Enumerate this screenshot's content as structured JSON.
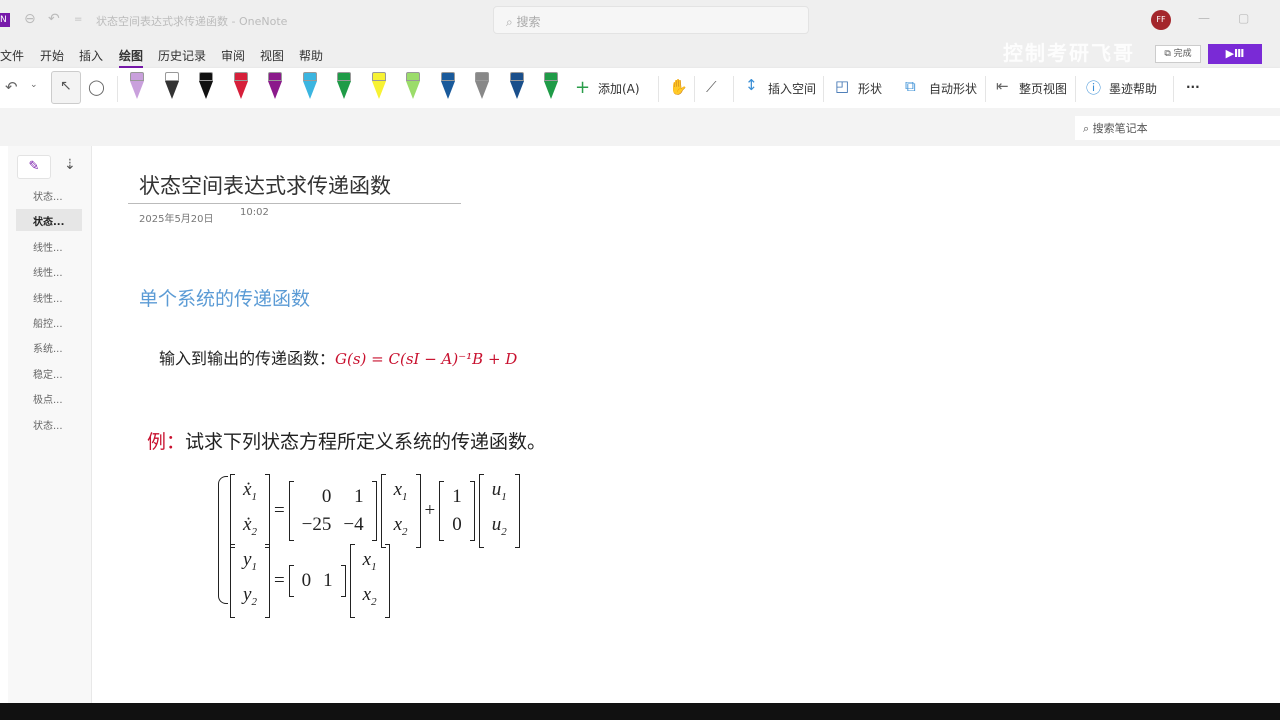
{
  "titlebar": {
    "app_badge": "N",
    "title": "状态空间表达式求传递函数 - OneNote",
    "search_placeholder": "搜索",
    "avatar": "FF"
  },
  "menu": [
    "文件",
    "开始",
    "插入",
    "绘图",
    "历史记录",
    "审阅",
    "视图",
    "帮助"
  ],
  "watermark": {
    "text": "控制考研飞哥",
    "btn": "⧉ 完成",
    "play": "▶Ⅲ"
  },
  "toolbar": {
    "pens": [
      {
        "cap": "#c9a0dc",
        "tip": "#c9a0dc"
      },
      {
        "cap": "#fff",
        "tip": "#333"
      },
      {
        "cap": "#111",
        "tip": "#111"
      },
      {
        "cap": "#d61f3a",
        "tip": "#d61f3a"
      },
      {
        "cap": "#8b1a8b",
        "tip": "#8b1a8b"
      },
      {
        "cap": "#3bb5e0",
        "tip": "#3bb5e0"
      },
      {
        "cap": "#1f9b47",
        "tip": "#1f9b47"
      },
      {
        "cap": "#f7f233",
        "tip": "#f7f233"
      },
      {
        "cap": "#9bdc6a",
        "tip": "#9bdc6a"
      },
      {
        "cap": "#1a5a9b",
        "tip": "#1a5a9b"
      },
      {
        "cap": "#888",
        "tip": "#888"
      },
      {
        "cap": "#1a4f8b",
        "tip": "#1a4f8b"
      },
      {
        "cap": "#1f9b47",
        "tip": "#1f9b47"
      }
    ],
    "add": "添加(A)",
    "insert_space": "插入空间",
    "shapes": "形状",
    "auto_shapes": "自动形状",
    "full_page_view": "整页视图",
    "ink_help": "墨迹帮助",
    "more": "···"
  },
  "notebook_search": "搜索笔记本",
  "pages": [
    "状态...",
    "状态...",
    "线性...",
    "线性...",
    "线性...",
    "船控...",
    "系统...",
    "稳定...",
    "极点...",
    "状态..."
  ],
  "active_page": 1,
  "page": {
    "title": "状态空间表达式求传递函数",
    "date": "2025年5月20日",
    "time": "10:02",
    "heading": "单个系统的传递函数",
    "io_label": "输入到输出的传递函数：",
    "formula": "G(s) = C(sI − A)⁻¹B + D",
    "example_label": "例：",
    "example_text": "试求下列状态方程所定义系统的传递函数。",
    "A": [
      "0",
      "1",
      "−25",
      "−4"
    ],
    "B": [
      "1",
      "0"
    ],
    "C": [
      "0",
      "1"
    ]
  }
}
